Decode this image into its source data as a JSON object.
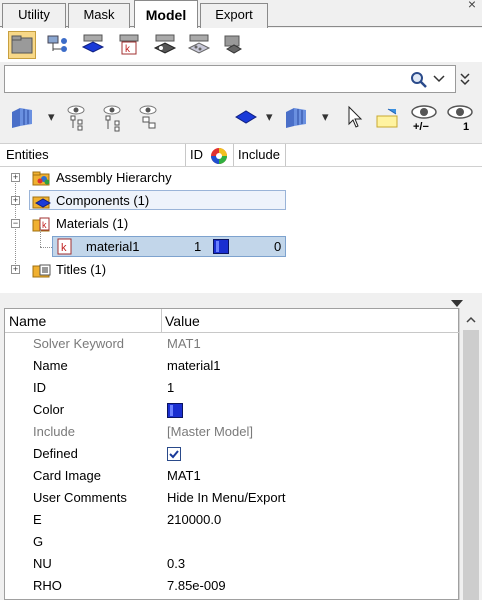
{
  "tabs": [
    {
      "label": "Utility",
      "active": false
    },
    {
      "label": "Mask",
      "active": false
    },
    {
      "label": "Model",
      "active": true
    },
    {
      "label": "Export",
      "active": false
    }
  ],
  "close_label": "×",
  "search": {
    "value": "",
    "placeholder": ""
  },
  "toolbar2": {
    "show_count_label": "+/−",
    "show_one_label": "1"
  },
  "entities_header": {
    "entities": "Entities",
    "id": "ID",
    "include": "Include"
  },
  "tree": {
    "items": [
      {
        "label": "Assembly Hierarchy",
        "expander": "+"
      },
      {
        "label": "Components (1)",
        "expander": "+"
      },
      {
        "label": "Materials (1)",
        "expander": "−"
      },
      {
        "label": "material1",
        "id": "1",
        "include": "0",
        "color": "#1a2fd0"
      },
      {
        "label": "Titles (1)",
        "expander": "+"
      }
    ]
  },
  "properties": {
    "header": {
      "name": "Name",
      "value": "Value"
    },
    "rows": [
      {
        "name": "Solver Keyword",
        "value": "MAT1",
        "muted": true
      },
      {
        "name": "Name",
        "value": "material1"
      },
      {
        "name": "ID",
        "value": "1"
      },
      {
        "name": "Color",
        "value": "",
        "swatch": "#1a2fd0"
      },
      {
        "name": "Include",
        "value": "[Master Model]",
        "muted": true
      },
      {
        "name": "Defined",
        "value": "",
        "checked": true
      },
      {
        "name": "Card Image",
        "value": "MAT1"
      },
      {
        "name": "User Comments",
        "value": "Hide In Menu/Export"
      },
      {
        "name": "E",
        "value": "210000.0"
      },
      {
        "name": "G",
        "value": ""
      },
      {
        "name": "NU",
        "value": "0.3"
      },
      {
        "name": "RHO",
        "value": "7.85e-009"
      }
    ]
  },
  "colors": {
    "accent": "#1a2fd0",
    "selection": "#c2d6ea"
  }
}
